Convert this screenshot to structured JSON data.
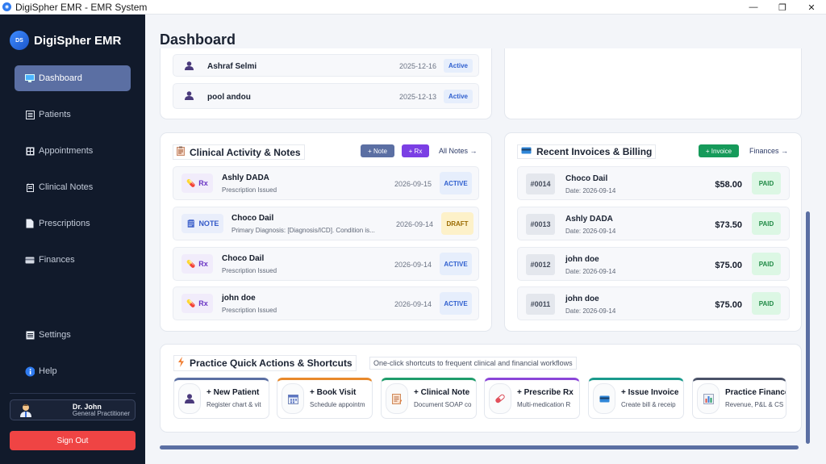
{
  "window": {
    "title": "DigiSpher EMR - EMR System",
    "minimize": "—",
    "restore": "❐",
    "close": "✕"
  },
  "sidebar": {
    "brand": "DigiSpher EMR",
    "logo_text": "DS",
    "items": [
      {
        "label": "Dashboard",
        "icon": "monitor-icon",
        "active": true
      },
      {
        "label": "Patients",
        "icon": "list-icon"
      },
      {
        "label": "Appointments",
        "icon": "grid-icon"
      },
      {
        "label": "Clinical Notes",
        "icon": "notepad-icon"
      },
      {
        "label": "Prescriptions",
        "icon": "document-icon"
      },
      {
        "label": "Finances",
        "icon": "card-icon"
      }
    ],
    "settings": "Settings",
    "help": "Help",
    "user": {
      "name": "Dr. John",
      "role": "General Practitioner"
    },
    "sign_out": "Sign Out"
  },
  "page": {
    "title": "Dashboard"
  },
  "patients_top": [
    {
      "name": "Ashraf Selmi",
      "date": "2025-12-16",
      "status": "Active"
    },
    {
      "name": "pool andou",
      "date": "2025-12-13",
      "status": "Active"
    }
  ],
  "clinical": {
    "title": "Clinical Activity & Notes",
    "note_btn": "+ Note",
    "rx_btn": "+ Rx",
    "all_link": "All Notes →",
    "rows": [
      {
        "tag": "Rx",
        "name": "Ashly DADA",
        "sub": "Prescription Issued",
        "date": "2026-09-15",
        "status": "ACTIVE"
      },
      {
        "tag": "NOTE",
        "name": "Choco Dail",
        "sub": "Primary Diagnosis: [Diagnosis/ICD]. Condition is...",
        "date": "2026-09-14",
        "status": "DRAFT"
      },
      {
        "tag": "Rx",
        "name": "Choco Dail",
        "sub": "Prescription Issued",
        "date": "2026-09-14",
        "status": "ACTIVE"
      },
      {
        "tag": "Rx",
        "name": "john doe",
        "sub": "Prescription Issued",
        "date": "2026-09-14",
        "status": "ACTIVE"
      }
    ]
  },
  "invoices": {
    "title": "Recent Invoices & Billing",
    "add_btn": "+ Invoice",
    "link": "Finances →",
    "rows": [
      {
        "num": "#0014",
        "name": "Choco Dail",
        "date": "Date: 2026-09-14",
        "amount": "$58.00",
        "status": "PAID"
      },
      {
        "num": "#0013",
        "name": "Ashly DADA",
        "date": "Date: 2026-09-14",
        "amount": "$73.50",
        "status": "PAID"
      },
      {
        "num": "#0012",
        "name": "john doe",
        "date": "Date: 2026-09-14",
        "amount": "$75.00",
        "status": "PAID"
      },
      {
        "num": "#0011",
        "name": "john doe",
        "date": "Date: 2026-09-14",
        "amount": "$75.00",
        "status": "PAID"
      }
    ]
  },
  "quick": {
    "title": "Practice Quick Actions & Shortcuts",
    "subtitle": "One-click shortcuts to frequent clinical and financial workflows",
    "cards": [
      {
        "label": "+ New Patient",
        "desc": "Register chart & vit",
        "color": "#5b6fa3"
      },
      {
        "label": "+ Book Visit",
        "desc": "Schedule appointm",
        "color": "#e8892b"
      },
      {
        "label": "+ Clinical Note",
        "desc": "Document SOAP co",
        "color": "#1f9d6b"
      },
      {
        "label": "+ Prescribe Rx",
        "desc": "Multi-medication R",
        "color": "#8b45d8"
      },
      {
        "label": "+ Issue Invoice",
        "desc": "Create bill & receip",
        "color": "#1a9a8c"
      },
      {
        "label": "Practice Finance",
        "desc": "Revenue, P&L & CS",
        "color": "#4a5268"
      }
    ]
  },
  "colors": {
    "accent": "#5b6fa3",
    "sidebar_bg": "#111a2b",
    "danger": "#ef4444",
    "success": "#1f8a45",
    "rx_btn": "#7b3fe4",
    "invoice_btn": "#169a5a"
  }
}
